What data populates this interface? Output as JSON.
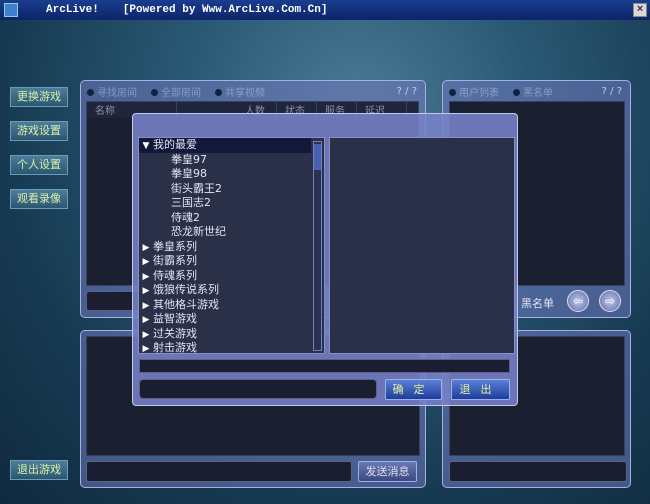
{
  "window": {
    "title": "ArcLive!",
    "powered": "[Powered by Www.ArcLive.Com.Cn]",
    "close": "×"
  },
  "sidebar": [
    "更换游戏",
    "游戏设置",
    "个人设置",
    "观看录像"
  ],
  "exit_game": "退出游戏",
  "room_panel": {
    "tabs": [
      "寻找房间",
      "全部房间",
      "共享视频"
    ],
    "pager": "? / ?",
    "columns": [
      "名称",
      "人数",
      "状态",
      "服务",
      "延迟"
    ]
  },
  "user_panel": {
    "tabs": [
      "用户列表",
      "黑名单"
    ],
    "pager": "? / ?",
    "blacklist": "黑名单",
    "prev": "⇦",
    "next": "⇨"
  },
  "chat": {
    "send": "发送消息"
  },
  "dialog": {
    "tree": [
      {
        "label": "我的最爱",
        "expanded": true,
        "children": [
          "拳皇97",
          "拳皇98",
          "街头霸王2",
          "三国志2",
          "侍魂2",
          "恐龙新世纪"
        ]
      },
      {
        "label": "拳皇系列"
      },
      {
        "label": "街霸系列"
      },
      {
        "label": "侍魂系列"
      },
      {
        "label": "饿狼传说系列"
      },
      {
        "label": "其他格斗游戏"
      },
      {
        "label": "益智游戏"
      },
      {
        "label": "过关游戏"
      },
      {
        "label": "射击游戏"
      }
    ],
    "ok": "确定",
    "cancel": "退出",
    "expanded_icon": "▼",
    "collapsed_icon": "▶"
  }
}
